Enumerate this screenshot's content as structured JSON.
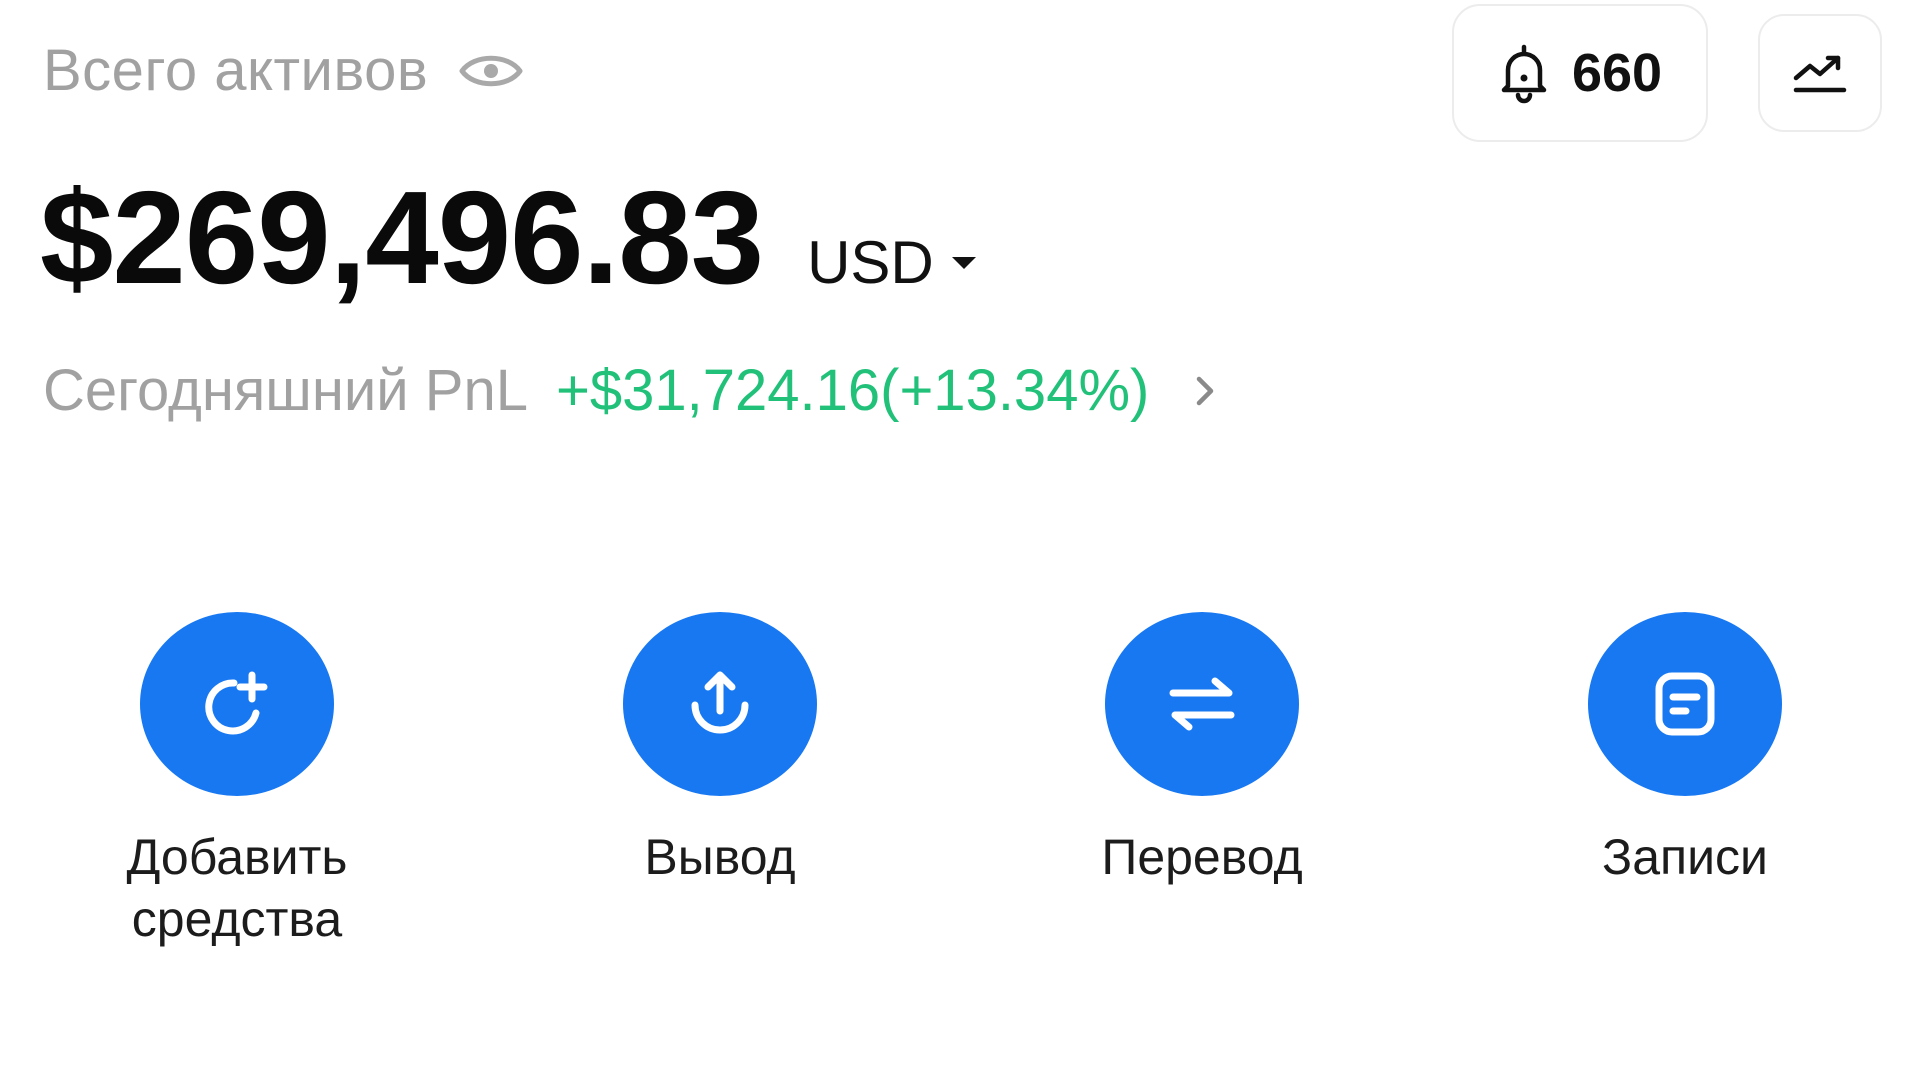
{
  "header": {
    "assets_label": "Всего активов",
    "eye_icon": "eye-icon",
    "notifications": {
      "icon": "bell-icon",
      "count": "660"
    },
    "chart_icon": "trend-chart-icon"
  },
  "balance": {
    "amount": "$269,496.83",
    "currency": "USD"
  },
  "pnl": {
    "label": "Сегодняшний PnL",
    "value": "+$31,724.16(+13.34%)"
  },
  "actions": [
    {
      "label_line1": "Добавить",
      "label_line2": "средства",
      "icon": "deposit-icon"
    },
    {
      "label": "Вывод",
      "icon": "withdraw-icon"
    },
    {
      "label": "Перевод",
      "icon": "transfer-icon"
    },
    {
      "label": "Записи",
      "icon": "records-icon"
    }
  ],
  "colors": {
    "accent": "#1778f2",
    "positive": "#22c17a",
    "muted_text": "#a1a1a1"
  }
}
